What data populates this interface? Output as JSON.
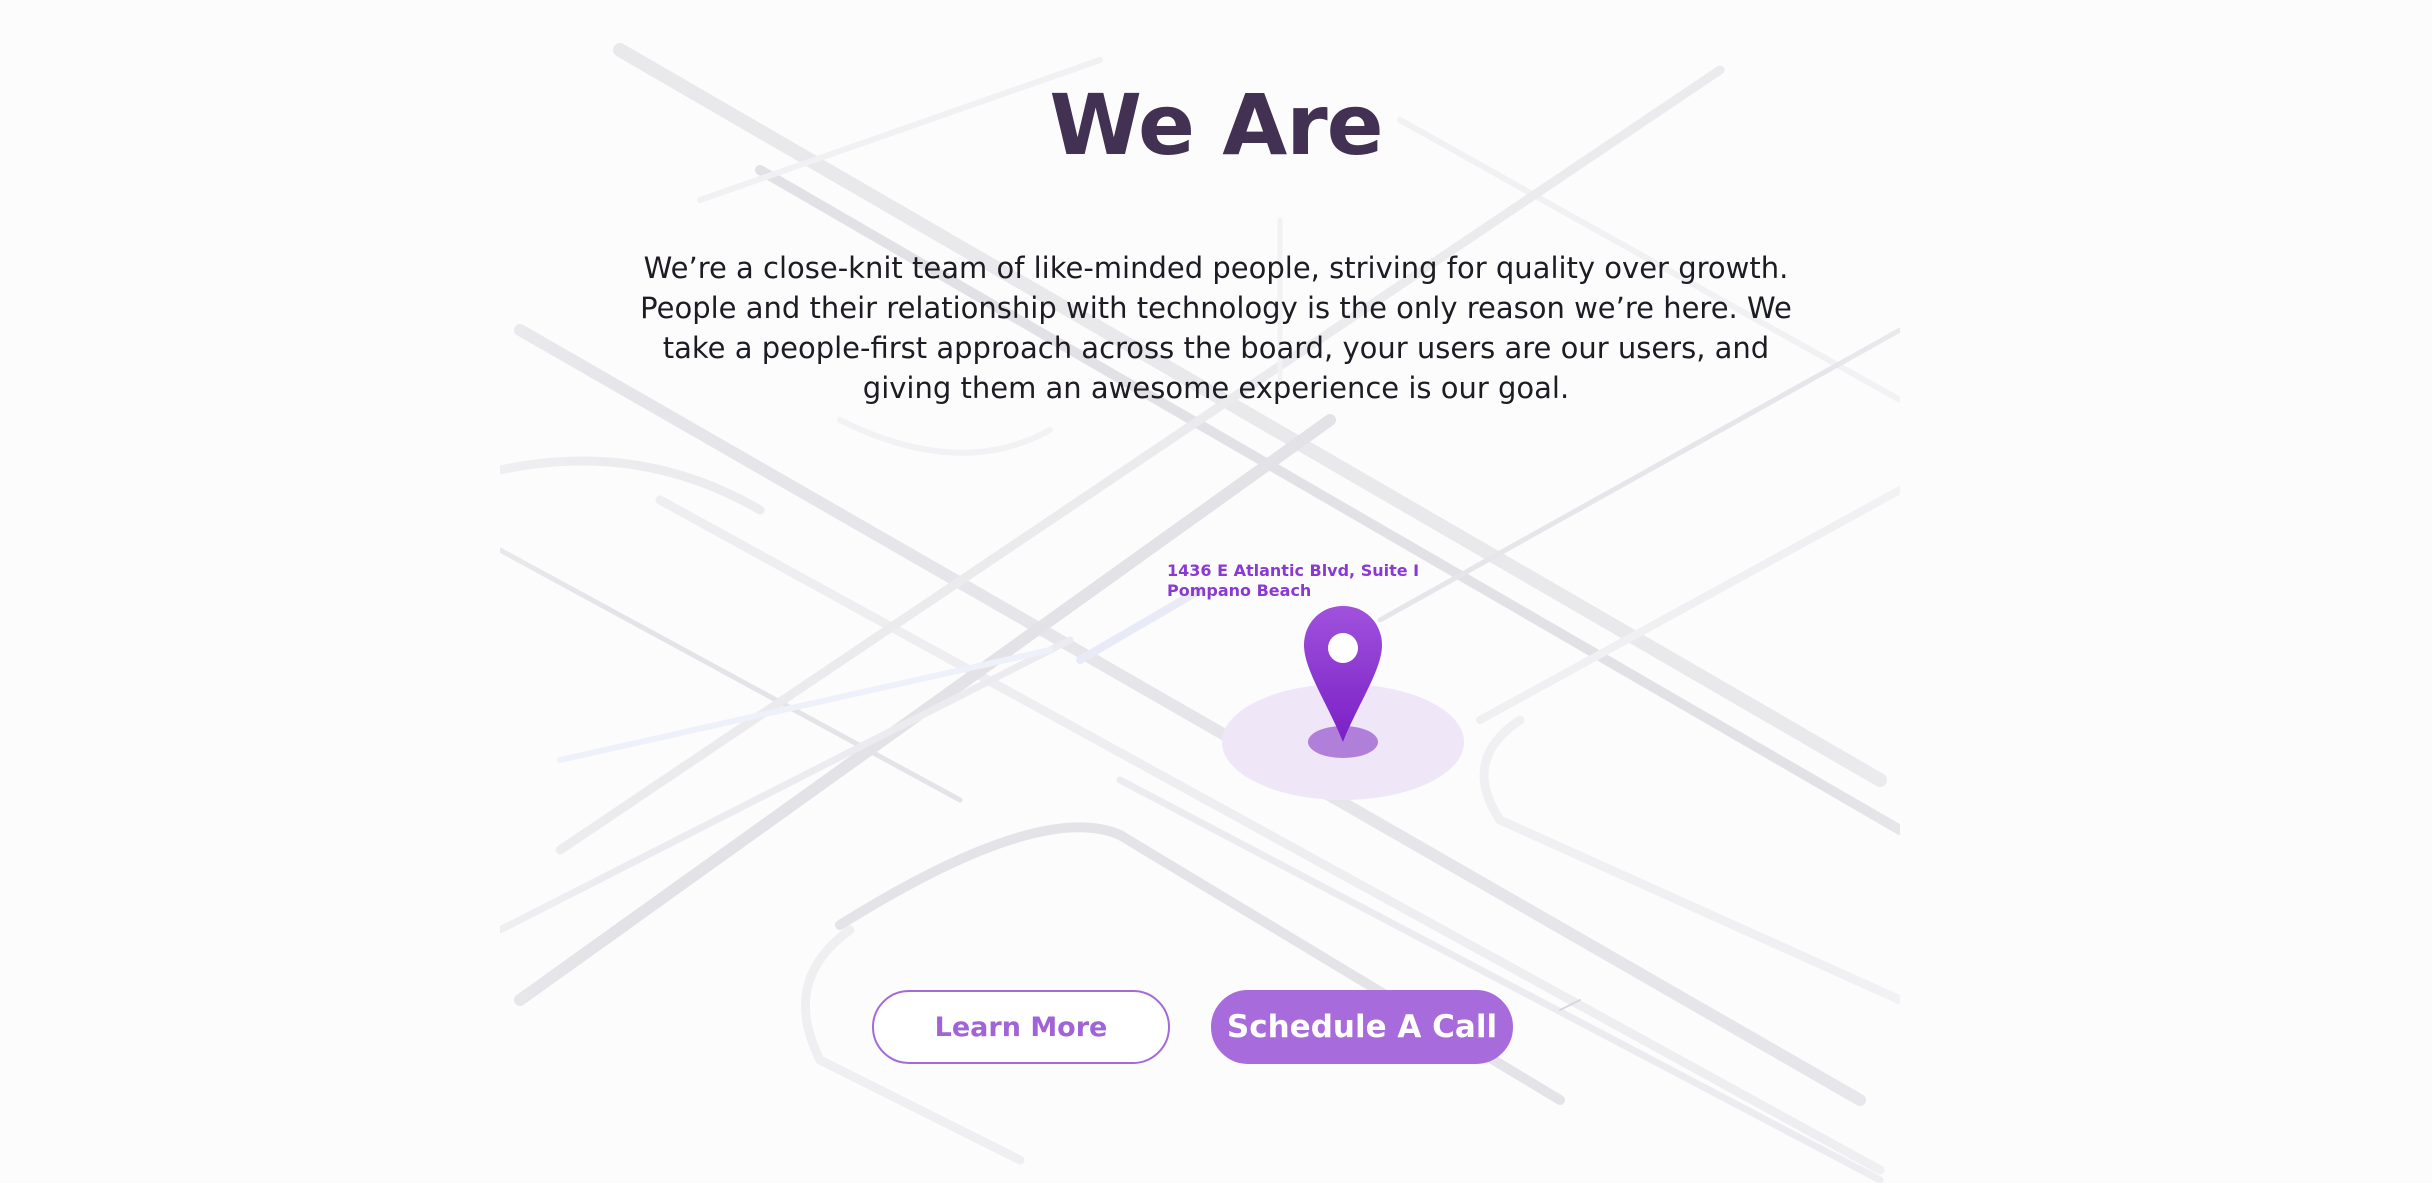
{
  "hero": {
    "title": "We Are",
    "intro_lines": [
      "We’re a close-knit team of like-minded people, striving for quality over growth.",
      "People and their relationship with technology is the only reason we’re here. We",
      "take a people-first approach across the board, your users are our users, and",
      "giving them an awesome experience is our goal."
    ]
  },
  "map": {
    "address_lines": [
      "1436 E Atlantic Blvd, Suite I",
      "Pompano Beach"
    ],
    "pin_icon": "map-pin-icon",
    "pin_color": "#8a32d0",
    "halo_color": "#efe6f7"
  },
  "actions": {
    "learn_more_label": "Learn More",
    "schedule_call_label": "Schedule A Call",
    "accent_color": "#a86bdb"
  }
}
